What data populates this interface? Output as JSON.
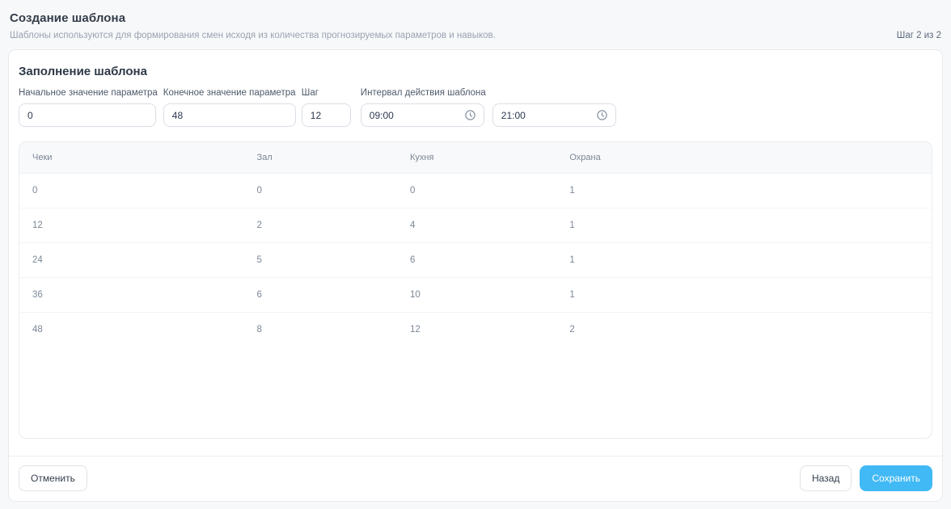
{
  "header": {
    "title": "Создание шаблона",
    "subtitle": "Шаблоны используются для формирования смен исходя из количества прогнозируемых параметров и навыков.",
    "step": "Шаг 2 из 2"
  },
  "form": {
    "section_title": "Заполнение шаблона",
    "fields": {
      "start": {
        "label": "Начальное значение параметра",
        "value": "0"
      },
      "end": {
        "label": "Конечное значение параметра",
        "value": "48"
      },
      "step": {
        "label": "Шаг",
        "value": "12"
      },
      "interval": {
        "label": "Интервал действия шаблона",
        "from": "09:00",
        "to": "21:00"
      }
    }
  },
  "table": {
    "columns": [
      "Чеки",
      "Зал",
      "Кухня",
      "Охрана"
    ],
    "rows": [
      [
        "0",
        "0",
        "0",
        "1"
      ],
      [
        "12",
        "2",
        "4",
        "1"
      ],
      [
        "24",
        "5",
        "6",
        "1"
      ],
      [
        "36",
        "6",
        "10",
        "1"
      ],
      [
        "48",
        "8",
        "12",
        "2"
      ]
    ]
  },
  "footer": {
    "cancel": "Отменить",
    "back": "Назад",
    "save": "Сохранить"
  },
  "icons": {
    "clock": "clock-icon"
  },
  "colors": {
    "accent": "#41b9f5",
    "page_background": "#f7f8fa",
    "card_border": "#e8eaee",
    "muted_text": "#7b8796"
  }
}
